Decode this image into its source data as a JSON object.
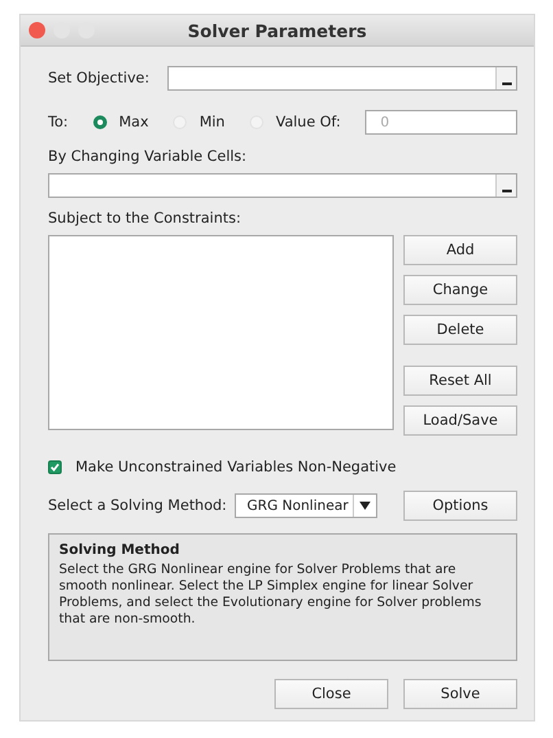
{
  "window": {
    "title": "Solver Parameters"
  },
  "objective": {
    "label": "Set Objective:"
  },
  "to": {
    "label": "To:",
    "options": [
      {
        "label": "Max",
        "selected": true
      },
      {
        "label": "Min",
        "selected": false
      },
      {
        "label": "Value Of:",
        "selected": false
      }
    ],
    "value_field": "0"
  },
  "changing_cells": {
    "label": "By Changing Variable Cells:"
  },
  "constraints": {
    "label": "Subject to the Constraints:",
    "buttons": [
      "Add",
      "Change",
      "Delete",
      "Reset All",
      "Load/Save"
    ]
  },
  "non_negative": {
    "label": "Make Unconstrained Variables Non-Negative",
    "checked": true
  },
  "solving_method": {
    "label": "Select a Solving Method:",
    "value": "GRG Nonlinear",
    "options_button": "Options"
  },
  "info": {
    "title": "Solving Method",
    "text": "Select the GRG Nonlinear engine for Solver Problems that are smooth nonlinear. Select the LP Simplex engine for linear Solver Problems, and select the Evolutionary engine for Solver problems that are non-smooth."
  },
  "buttons": [
    "Close",
    "Solve"
  ]
}
